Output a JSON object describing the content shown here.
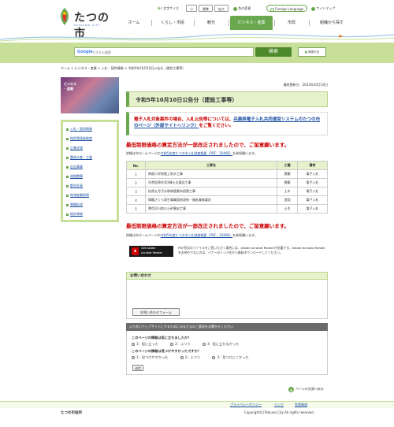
{
  "header": {
    "logo_text": "たつの市",
    "logo_sub": "TATSUNO CITY",
    "util": {
      "text_size_label": "文字サイズ",
      "small": "小",
      "standard": "標準",
      "large": "拡大",
      "color_label": "色の変更",
      "foreign_language": "Foreign Language",
      "sitemap": "サイトマップ"
    },
    "gnav": [
      "ホーム",
      "くらし・市民",
      "観光",
      "ビジネス・産業",
      "市政",
      "組織から探す"
    ],
    "gnav_active_index": 3
  },
  "search": {
    "brand": "Google",
    "placeholder": "カスタム検索",
    "button": "検索",
    "help": "検索方法"
  },
  "breadcrumb": "ホーム > ビジネス・産業 > 入札・契約情報 > 令和5年10月10日公告分（建設工事等）",
  "sidebar": {
    "photo_label_1": "ビジネス",
    "photo_label_2": "・産業",
    "items": [
      "入札・契約情報",
      "指定管理者制度",
      "企業支援",
      "農林水産・工業",
      "広告事業",
      "道路整備",
      "都市計画",
      "地域産業振興",
      "景観形成",
      "統計情報"
    ]
  },
  "main": {
    "updated": "最終更新日：2023年10月10日",
    "title": "令和5年10月10日公告分（建設工事等）",
    "notice_pre": "電子入札対象案件の場合、入札公告等については、",
    "notice_link": "兵庫県電子入札共同運営システムのたつの市のページ（外部サイトへリンク）",
    "notice_post": "をご覧ください。",
    "warn": "最低制限価格の算定方法が一部改正されましたので、ご留意願います。",
    "detail_pre": "詳細は市ホームページの",
    "detail_link": "令和5年度たつの市入札制度概要（PDF：204KB）",
    "detail_post": "を参照願います。",
    "table": {
      "headers": [
        "No.",
        "工事名",
        "工種",
        "備考"
      ],
      "rows": [
        [
          "1",
          "神部小学校屋上防水工事",
          "建築",
          "電子入札"
        ],
        [
          "2",
          "市営松原住宅3棟火災復旧工事",
          "建築",
          "電子入札"
        ],
        [
          "3",
          "松原五号汚水幹線管渠布設替工事",
          "土木",
          "電子入札"
        ],
        [
          "4",
          "揖龍さくら再生事業園地改修・福祉業務委託",
          "造園",
          "電子入札"
        ],
        [
          "5",
          "準用河川前川土砂撤去工事",
          "土木",
          "電子入札"
        ]
      ]
    },
    "pdf": {
      "badge_line1": "Get Adobe",
      "badge_line2": "Acrobat Reader",
      "text": "PDF形式のファイルをご覧いただく場合には、Adobe Acrobat Readerが必要です。Adobe Acrobat Readerをお持ちでない方は、バナーのリンク先から無料ダウンロードしてください。"
    },
    "contact": {
      "head": "お問い合わせ",
      "dept": "",
      "address": "",
      "tel": "",
      "fax": "",
      "button": "お問い合わせフォーム"
    },
    "survey": {
      "head": "より良いウェブサイトにするためにみなさまのご意見をお聞かせください",
      "q1": "このページの情報は役に立ちましたか？",
      "q1_opts": [
        "1：役に立った",
        "2：ふつう",
        "3：役に立たなかった"
      ],
      "q2": "このページの情報は見つけやすかったですか？",
      "q2_opts": [
        "1：見つけやすかった",
        "2：ふつう",
        "3：見つけにくかった"
      ],
      "send": "送信"
    },
    "pagetop": "ページの先頭へ戻る"
  },
  "footer": {
    "links": [
      "プライバシーポリシー",
      "リンク",
      "免責事項"
    ],
    "name": "たつの市役所",
    "address": "",
    "tel": "",
    "copyright": "Copyright(C)Tatsuno City All rights reserved."
  },
  "colors": {
    "brand_green": "#6aa84f",
    "band_green": "#c8df9a",
    "alert_red": "#cc0000",
    "link_blue": "#1a4fa0"
  }
}
